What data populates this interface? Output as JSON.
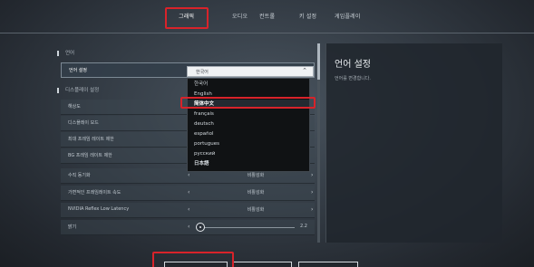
{
  "nav": {
    "tabs": [
      {
        "label": "그래픽",
        "active": true
      },
      {
        "label": "오디오",
        "active": false
      },
      {
        "label": "컨트롤",
        "active": false
      },
      {
        "label": "키 설정",
        "active": false
      },
      {
        "label": "게임플레이",
        "active": false
      }
    ]
  },
  "sections": {
    "language": "언어",
    "display": "디스플레이 설정"
  },
  "rows": {
    "language": {
      "label": "언어 설정"
    },
    "resolution": {
      "label": "해상도"
    },
    "display_mode": {
      "label": "디스플레이 모드"
    },
    "max_fps": {
      "label": "최대 프레임 레이트 제한"
    },
    "bg_fps": {
      "label": "BG 프레임 레이트 제한"
    },
    "vsync": {
      "label": "수직 동기화",
      "value": "비활성화"
    },
    "variable_rate": {
      "label": "가변적인 프레임레이트 속도",
      "value": "비활성화"
    },
    "reflex": {
      "label": "NVIDIA Reflex Low Latency",
      "value": "비활성화"
    },
    "brightness": {
      "label": "밝기",
      "value": "2.2"
    }
  },
  "dropdown": {
    "selected": "한국어",
    "options": [
      "한국어",
      "English",
      "简体中文",
      "français",
      "deutsch",
      "español",
      "portugues",
      "русский",
      "日本語"
    ]
  },
  "info": {
    "title": "언어 설정",
    "description": "언어를 변경합니다."
  },
  "colors": {
    "highlight": "#d8232a"
  }
}
